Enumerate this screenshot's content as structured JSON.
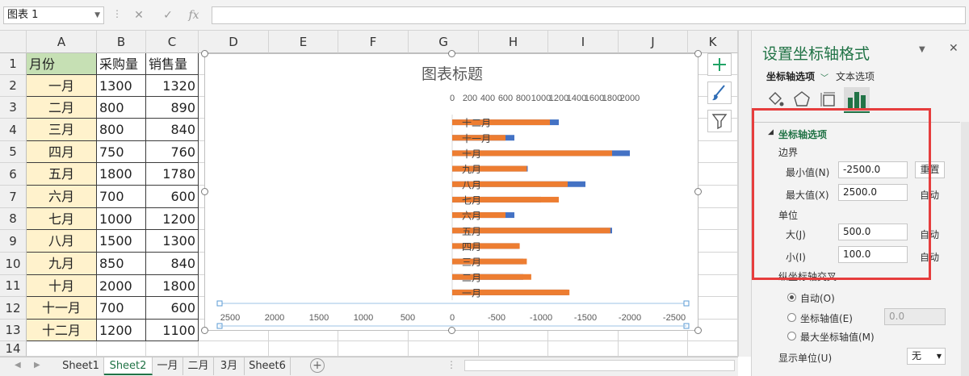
{
  "namebox": {
    "value": "图表 1",
    "dropdown_icon": "chevron-down-icon"
  },
  "formula": {
    "cancel_icon": "close-icon",
    "enter_icon": "check-icon",
    "fx_label": "fx",
    "value": ""
  },
  "columns": [
    "A",
    "B",
    "C",
    "D",
    "E",
    "F",
    "G",
    "H",
    "I",
    "J",
    "K"
  ],
  "rows": [
    "1",
    "2",
    "3",
    "4",
    "5",
    "6",
    "7",
    "8",
    "9",
    "10",
    "11",
    "12",
    "13",
    "14"
  ],
  "table": {
    "headers": [
      "月份",
      "采购量",
      "销售量"
    ],
    "data": [
      [
        "一月",
        "1300",
        "1320"
      ],
      [
        "二月",
        "800",
        "890"
      ],
      [
        "三月",
        "800",
        "840"
      ],
      [
        "四月",
        "750",
        "760"
      ],
      [
        "五月",
        "1800",
        "1780"
      ],
      [
        "六月",
        "700",
        "600"
      ],
      [
        "七月",
        "1000",
        "1200"
      ],
      [
        "八月",
        "1500",
        "1300"
      ],
      [
        "九月",
        "850",
        "840"
      ],
      [
        "十月",
        "2000",
        "1800"
      ],
      [
        "十一月",
        "700",
        "600"
      ],
      [
        "十二月",
        "1200",
        "1100"
      ]
    ]
  },
  "chart_data": {
    "type": "bar",
    "title": "图表标题",
    "categories": [
      "十二月",
      "十一月",
      "十月",
      "九月",
      "八月",
      "七月",
      "六月",
      "五月",
      "四月",
      "三月",
      "二月",
      "一月"
    ],
    "series": [
      {
        "color": "#4472c4",
        "values": [
          -1200,
          -700,
          -2000,
          -850,
          -1500,
          -1000,
          -700,
          -1800,
          -750,
          -800,
          -800,
          -1300
        ]
      },
      {
        "color": "#ed7d31",
        "values": [
          -1100,
          -600,
          -1800,
          -840,
          -1300,
          -1200,
          -600,
          -1780,
          -760,
          -840,
          -890,
          -1320
        ]
      }
    ],
    "top_axis": {
      "range": [
        0,
        2000
      ],
      "ticks": [
        "0",
        "200",
        "400",
        "600",
        "800",
        "1000",
        "1200",
        "1400",
        "1600",
        "1800",
        "2000"
      ]
    },
    "bottom_axis": {
      "range": [
        2500,
        -2500
      ],
      "ticks": [
        "2500",
        "2000",
        "1500",
        "1000",
        "500",
        "0",
        "-500",
        "-1000",
        "-1500",
        "-2000",
        "-2500"
      ]
    }
  },
  "chart_buttons": [
    {
      "name": "add-element-icon",
      "symbol": "+"
    },
    {
      "name": "brush-icon",
      "symbol": "🖌"
    },
    {
      "name": "filter-icon",
      "symbol": "▽"
    }
  ],
  "panel": {
    "title": "设置坐标轴格式",
    "tabs": [
      "坐标轴选项",
      "文本选项"
    ],
    "icons": [
      "fill-icon",
      "pentagon-icon",
      "size-properties-icon",
      "bar-chart-icon"
    ],
    "section": "坐标轴选项",
    "bounds_label": "边界",
    "min_label": "最小值(N)",
    "min_value": "-2500.0",
    "reset_label": "重置",
    "max_label": "最大值(X)",
    "max_value": "2500.0",
    "auto_label": "自动",
    "units_label": "单位",
    "major_label": "大(J)",
    "major_value": "500.0",
    "minor_label": "小(I)",
    "minor_value": "100.0",
    "cross_label": "纵坐标轴交叉",
    "radio_auto": "自动(O)",
    "radio_value": "坐标轴值(E)",
    "axis_value": "0.0",
    "radio_max": "最大坐标轴值(M)",
    "display_units_label": "显示单位(U)",
    "display_units_value": "无"
  },
  "sheets": [
    "Sheet1",
    "Sheet2",
    "一月",
    "二月",
    "3月",
    "Sheet6"
  ],
  "active_sheet": "Sheet2",
  "colors": {
    "accent": "#217346",
    "highlight": "#e63d3d",
    "orange": "#ed7d31",
    "blue": "#4472c4"
  }
}
